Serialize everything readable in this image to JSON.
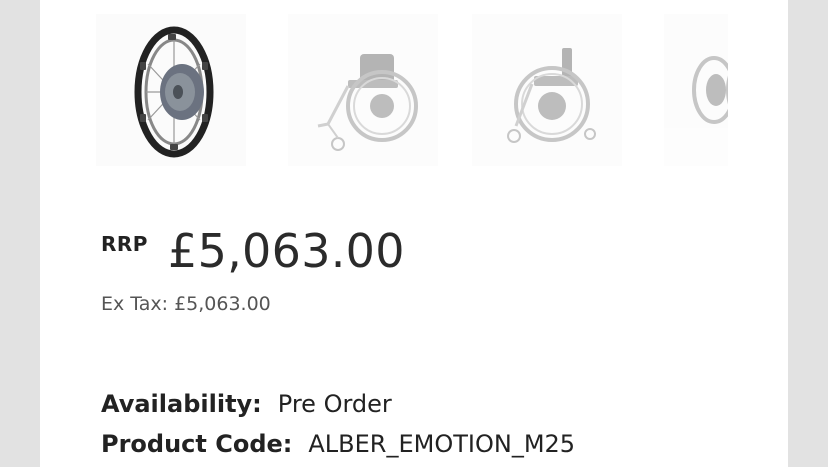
{
  "gallery": {
    "items": [
      {
        "name": "wheel-motor-thumbnail"
      },
      {
        "name": "wheelchair-side-thumbnail"
      },
      {
        "name": "wheelchair-front-thumbnail"
      },
      {
        "name": "wheel-partial-thumbnail"
      }
    ]
  },
  "pricing": {
    "rrp_label": "RRP",
    "price": "£5,063.00",
    "ex_tax": "Ex Tax: £5,063.00"
  },
  "specs": {
    "availability_label": "Availability:",
    "availability_value": "Pre Order",
    "product_code_label": "Product Code:",
    "product_code_value": "ALBER_EMOTION_M25"
  }
}
